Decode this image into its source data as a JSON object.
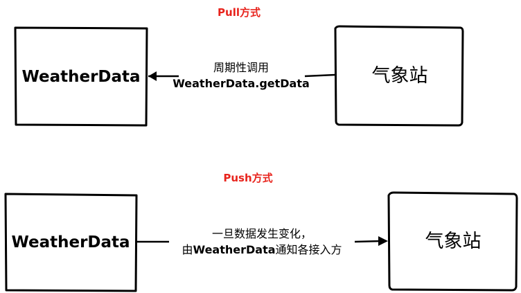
{
  "pull": {
    "title": "Pull方式",
    "left_box": "WeatherData",
    "right_box": "气象站",
    "label_line1": "周期性调用",
    "label_line2": "WeatherData.getData"
  },
  "push": {
    "title": "Push方式",
    "left_box": "WeatherData",
    "right_box": "气象站",
    "label_line1": "一旦数据发生变化，",
    "label_line2_pre": "由",
    "label_line2_bold": "WeatherData",
    "label_line2_post": "通知各接入方"
  },
  "colors": {
    "title": "#e8231c",
    "stroke": "#000000"
  }
}
